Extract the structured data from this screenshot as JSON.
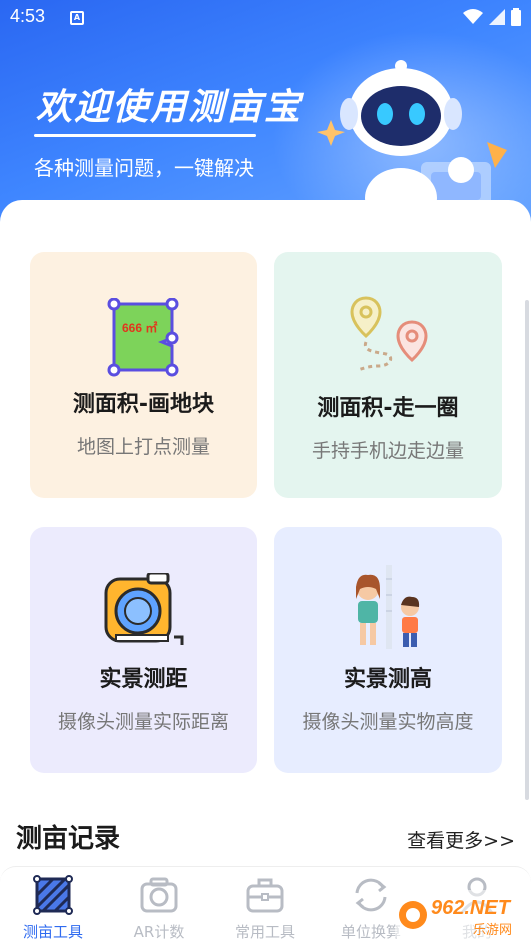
{
  "status_bar": {
    "time": "4:53",
    "notification_icon": "A"
  },
  "hero": {
    "title": "欢迎使用测亩宝",
    "subtitle": "各种测量问题，一键解决"
  },
  "cards": [
    {
      "title": "测面积-画地块",
      "desc": "地图上打点测量",
      "icon": "polygon-area-icon",
      "area_value": "666 ㎡",
      "bg": "#fdf1e1"
    },
    {
      "title": "测面积-走一圈",
      "desc": "手持手机边走边量",
      "icon": "route-pins-icon",
      "bg": "#e4f5ef"
    },
    {
      "title": "实景测距",
      "desc": "摄像头测量实际距离",
      "icon": "tape-measure-icon",
      "bg": "#ecebfd"
    },
    {
      "title": "实景测高",
      "desc": "摄像头测量实物高度",
      "icon": "height-kids-icon",
      "bg": "#e7edff"
    }
  ],
  "records": {
    "title": "测亩记录",
    "more": "查看更多>>"
  },
  "tabbar": {
    "items": [
      {
        "label": "测亩工具",
        "icon": "land-tool-icon",
        "active": true
      },
      {
        "label": "AR计数",
        "icon": "camera-icon",
        "active": false
      },
      {
        "label": "常用工具",
        "icon": "toolbox-icon",
        "active": false
      },
      {
        "label": "单位换算",
        "icon": "convert-icon",
        "active": false
      },
      {
        "label": "我的",
        "icon": "profile-icon",
        "active": false
      }
    ]
  },
  "watermark": {
    "brand": "962.NET",
    "sub": "乐游网"
  },
  "colors": {
    "primary": "#2f6bf0",
    "hero_start": "#2a67f2",
    "hero_end": "#6aa7ff",
    "inactive": "#b8bcc4"
  }
}
